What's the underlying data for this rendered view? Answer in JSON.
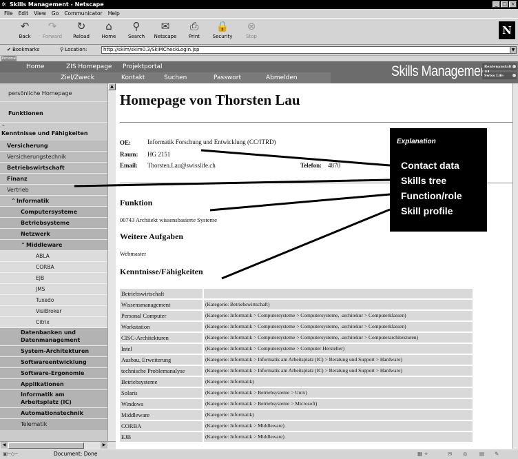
{
  "window": {
    "title": "Skills Management - Netscape",
    "buttons": [
      "_",
      "□",
      "×"
    ]
  },
  "menu": [
    "File",
    "Edit",
    "View",
    "Go",
    "Communicator",
    "Help"
  ],
  "toolbar": {
    "buttons": [
      {
        "label": "Back",
        "icon": "back-arrow-icon",
        "glyph": "↶",
        "enabled": true
      },
      {
        "label": "Forward",
        "icon": "forward-arrow-icon",
        "glyph": "↷",
        "enabled": false
      },
      {
        "label": "Reload",
        "icon": "reload-icon",
        "glyph": "↻",
        "enabled": true
      },
      {
        "label": "Home",
        "icon": "home-icon",
        "glyph": "⌂",
        "enabled": true
      },
      {
        "label": "Search",
        "icon": "search-icon",
        "glyph": "⚲",
        "enabled": true
      },
      {
        "label": "Netscape",
        "icon": "netscape-icon",
        "glyph": "✉",
        "enabled": true
      },
      {
        "label": "Print",
        "icon": "print-icon",
        "glyph": "⎙",
        "enabled": true
      },
      {
        "label": "Security",
        "icon": "security-lock-icon",
        "glyph": "🔒",
        "enabled": true
      },
      {
        "label": "Stop",
        "icon": "stop-icon",
        "glyph": "⊗",
        "enabled": false
      }
    ],
    "logo": "N"
  },
  "location": {
    "bookmarks_label": "Bookmarks",
    "location_label": "Location:",
    "url": "http://skim/skim0.3/SkiMCheckLogin.jsp"
  },
  "personal_tab": "Personal",
  "nav": {
    "row1": [
      "Home",
      "ZIS Homepage",
      "Projektportal"
    ],
    "row2": [
      "Ziel/Zweck",
      "Kontakt",
      "Suchen",
      "Passwort",
      "Abmelden"
    ],
    "brand": "Skills Management",
    "brand_buttons": [
      "Rentenanstalt",
      "Swiss Life"
    ]
  },
  "sidebar": {
    "items": [
      {
        "label": "persönliche Homepage"
      },
      {
        "label": "Funktionen"
      },
      {
        "label": "Kenntnisse und Fähigkeiten"
      },
      {
        "label": "Versicherung"
      },
      {
        "label": "Versicherungstechnik"
      },
      {
        "label": "Betriebswirtschaft"
      },
      {
        "label": "Finanz"
      },
      {
        "label": "Vertrieb"
      },
      {
        "label": "Informatik"
      },
      {
        "label": "Computersysteme"
      },
      {
        "label": "Betriebsysteme"
      },
      {
        "label": "Netzwerk"
      },
      {
        "label": "Middleware"
      },
      {
        "label": "ABLA"
      },
      {
        "label": "CORBA"
      },
      {
        "label": "EJB"
      },
      {
        "label": "JMS"
      },
      {
        "label": "Tuxedo"
      },
      {
        "label": "VisiBroker"
      },
      {
        "label": "Citrix"
      },
      {
        "label": "Datenbanken und"
      },
      {
        "label": "Datenmanagement"
      },
      {
        "label": "System-Architekturen"
      },
      {
        "label": "Softwareentwicklung"
      },
      {
        "label": "Software-Ergonomie"
      },
      {
        "label": "Applikationen"
      },
      {
        "label": "Informatik am"
      },
      {
        "label": "Arbeitsplatz (IC)"
      },
      {
        "label": "Automationstechnik"
      },
      {
        "label": "Telematik"
      }
    ]
  },
  "content": {
    "heading": "Homepage von Thorsten Lau",
    "oe_label": "OE:",
    "oe_value": "Informatik Forschung und Entwicklung (CC/ITRD)",
    "raum_label": "Raum:",
    "raum_value": "HG 2151",
    "email_label": "Email:",
    "email_value": "Thorsten.Lau@swisslife.ch",
    "telefon_label": "Telefon:",
    "telefon_value": "4870",
    "funktion_title": "Funktion",
    "funktion_value": "00743 Architekt wissensbasierte Systeme",
    "weitere_title": "Weitere Aufgaben",
    "weitere_value": "Webmaster",
    "kenntnisse_title": "Kenntnisse/Fähigkeiten",
    "skills": [
      {
        "name": "Betriebswirtschaft",
        "category": ""
      },
      {
        "name": "Wissensmanagement",
        "category": "(Kategorie: Betriebswirtschaft)"
      },
      {
        "name": "Personal Computer",
        "category": "(Kategorie: Informatik > Computersysteme > Computersysteme, -architekur > Computerklassen)"
      },
      {
        "name": "Workstation",
        "category": "(Kategorie: Informatik > Computersysteme > Computersysteme, -architekur > Computerklassen)"
      },
      {
        "name": "CISC-Architekturen",
        "category": "(Kategorie: Informatik > Computersysteme > Computersysteme, -architekur > Computerarchitekturen)"
      },
      {
        "name": "Intel",
        "category": "(Kategorie: Informatik > Computersysteme > Computer Hersteller)"
      },
      {
        "name": "Ausbau, Erweiterung",
        "category": "(Kategorie: Informatik > Informatik am Arbeitsplatz (IC) > Beratung und Support > Hardware)"
      },
      {
        "name": "technische Problemanalyse",
        "category": "(Kategorie: Informatik > Informatik am Arbeitsplatz (IC) > Beratung und Support > Hardware)"
      },
      {
        "name": "Betriebsysteme",
        "category": "(Kategorie: Informatik)"
      },
      {
        "name": "Solaris",
        "category": "(Kategorie: Informatik > Betriebsysteme > Unix)"
      },
      {
        "name": "Windows",
        "category": "(Kategorie: Informatik > Betriebsysteme > Microsoft)"
      },
      {
        "name": "Middleware",
        "category": "(Kategorie: Informatik)"
      },
      {
        "name": "CORBA",
        "category": "(Kategorie: Informatik > Middleware)"
      },
      {
        "name": "EJB",
        "category": "(Kategorie: Informatik > Middleware)"
      }
    ]
  },
  "explanation": {
    "title": "Explanation",
    "items": [
      "Contact data",
      "Skills tree",
      "Function/role",
      "Skill profile"
    ]
  },
  "status": {
    "text": "Document: Done"
  }
}
